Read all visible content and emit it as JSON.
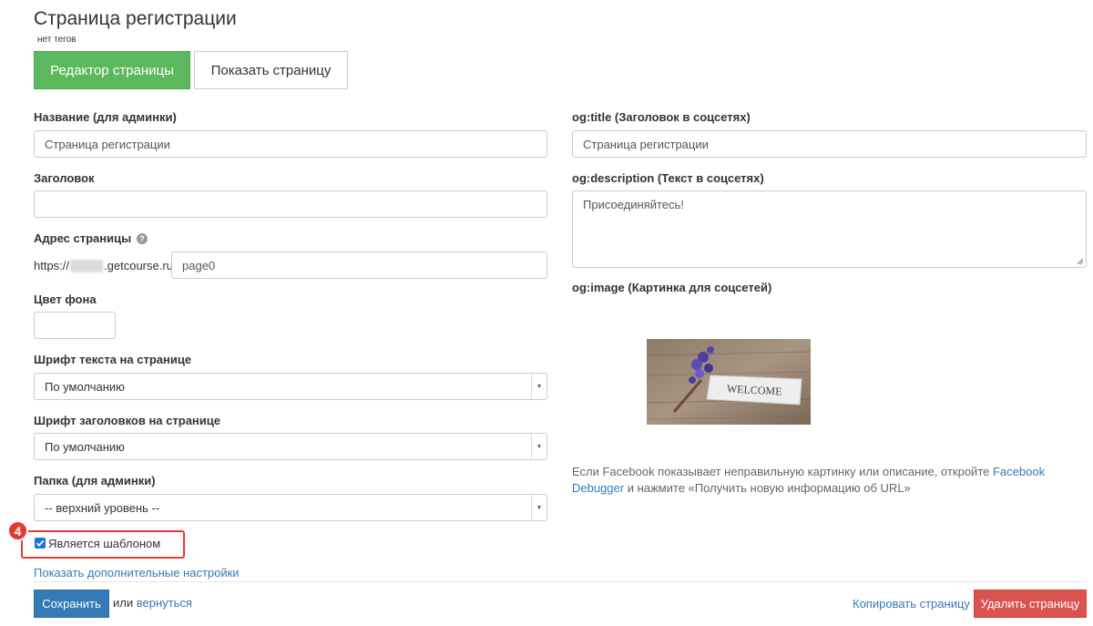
{
  "header": {
    "title": "Страница регистрации",
    "tags": "нет тегов"
  },
  "tabs": {
    "editor": "Редактор страницы",
    "show": "Показать страницу"
  },
  "form": {
    "name_label": "Название (для админки)",
    "name_value": "Страница регистрации",
    "heading_label": "Заголовок",
    "heading_value": "",
    "address_label": "Адрес страницы",
    "address_prefix_start": "https://",
    "address_prefix_end": ".getcourse.ru/",
    "address_value": "page0",
    "bg_color_label": "Цвет фона",
    "bg_color_value": "",
    "font_text_label": "Шрифт текста на странице",
    "font_text_value": "По умолчанию",
    "font_heading_label": "Шрифт заголовков на странице",
    "font_heading_value": "По умолчанию",
    "folder_label": "Папка (для админки)",
    "folder_value": "-- верхний уровень --",
    "template_checkbox_label": "Является шаблоном",
    "template_checked": true,
    "more_settings": "Показать дополнительные настройки"
  },
  "annotation": {
    "step_number": "4",
    "color": "#e53935"
  },
  "og": {
    "title_label": "og:title (Заголовок в соцсетях)",
    "title_value": "Страница регистрации",
    "description_label": "og:description (Текст в соцсетях)",
    "description_value": "Присоединяйтесь!",
    "image_label": "og:image (Картинка для соцсетей)",
    "image_caption": "WELCOME",
    "note_before": "Если Facebook показывает неправильную картинку или описание, откройте ",
    "note_link": "Facebook Debugger",
    "note_after": " и нажмите «Получить новую информацию об URL»"
  },
  "footer": {
    "save": "Сохранить",
    "or": "или",
    "back": "вернуться",
    "copy": "Копировать страницу",
    "delete": "Удалить страницу"
  },
  "colors": {
    "green": "#5cb85c",
    "blue": "#337ab7",
    "red": "#d9534f"
  }
}
